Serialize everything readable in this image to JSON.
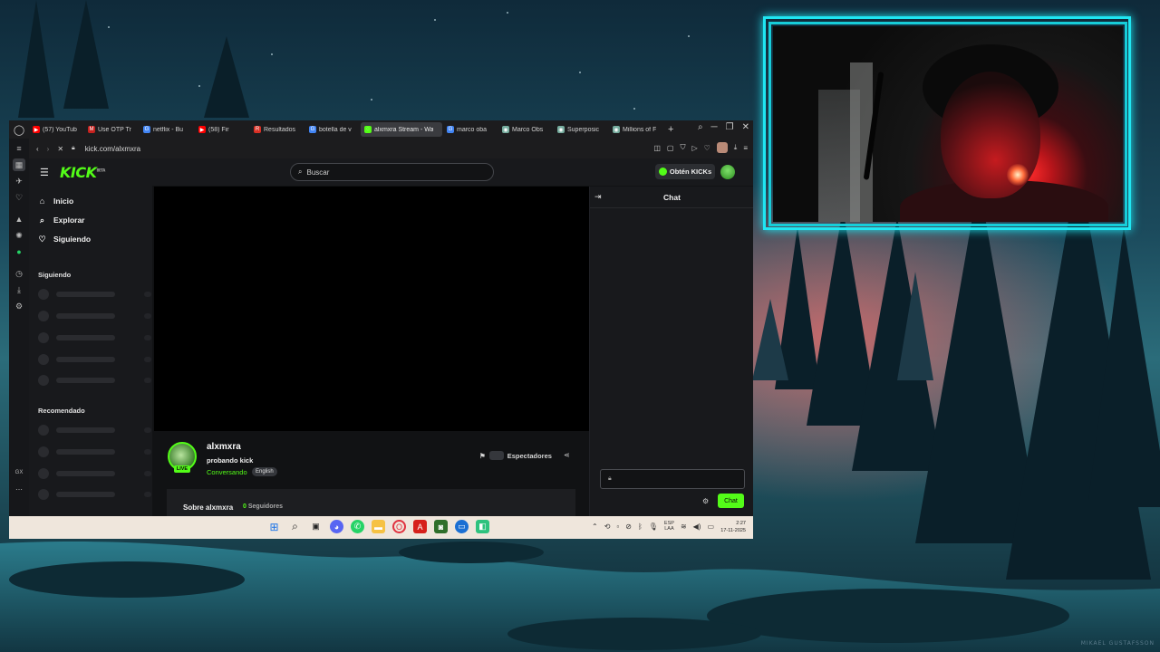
{
  "browser": {
    "tabs": [
      {
        "label": "(57) YouTub",
        "favicon_color": "#ff0000",
        "glyph": "▶"
      },
      {
        "label": "Use OTP Tr",
        "favicon_color": "#c5221f",
        "glyph": "M"
      },
      {
        "label": "netflix - Bu",
        "favicon_color": "#4285f4",
        "glyph": "G"
      },
      {
        "label": "(58) Fir",
        "favicon_color": "#ff0000",
        "glyph": "▶"
      },
      {
        "label": "Resultados",
        "favicon_color": "#d93025",
        "glyph": "R"
      },
      {
        "label": "botella de v",
        "favicon_color": "#4285f4",
        "glyph": "G"
      },
      {
        "label": "alxmxra Stream - Wa",
        "favicon_color": "#53fc18",
        "glyph": "◌",
        "active": true
      },
      {
        "label": "marco oba",
        "favicon_color": "#4285f4",
        "glyph": "G"
      },
      {
        "label": "Marco Obs",
        "favicon_color": "#74aa9c",
        "glyph": "◉"
      },
      {
        "label": "Superposic",
        "favicon_color": "#74aa9c",
        "glyph": "◉"
      },
      {
        "label": "Millions of F",
        "favicon_color": "#74aa9c",
        "glyph": "◉"
      }
    ],
    "url": "kick.com/alxmxra"
  },
  "kick": {
    "search_placeholder": "Buscar",
    "get_kicks_label": "Obtén KICKs",
    "nav": {
      "home": "Inicio",
      "explore": "Explorar",
      "following": "Siguiendo"
    },
    "sections": {
      "following": "Siguiendo",
      "recommended": "Recomendado"
    },
    "channel": {
      "name": "alxmxra",
      "stream_title": "probando kick",
      "category": "Conversando",
      "language": "English",
      "live_badge": "LIVE",
      "viewers_label": "Espectadores"
    },
    "about": {
      "title": "Sobre alxmxra",
      "followers_count": "0",
      "followers_label": "Seguidores"
    },
    "chat": {
      "title": "Chat",
      "send_label": "Chat"
    },
    "brand_color": "#53fc18"
  },
  "taskbar": {
    "lang_line1": "ESP",
    "lang_line2": "LAA",
    "time": "2:27",
    "date": "17-11-2025",
    "sidebar_bottom_label": "GX"
  },
  "wallpaper": {
    "watermark": "MIKAEL GUSTAFSSON"
  }
}
